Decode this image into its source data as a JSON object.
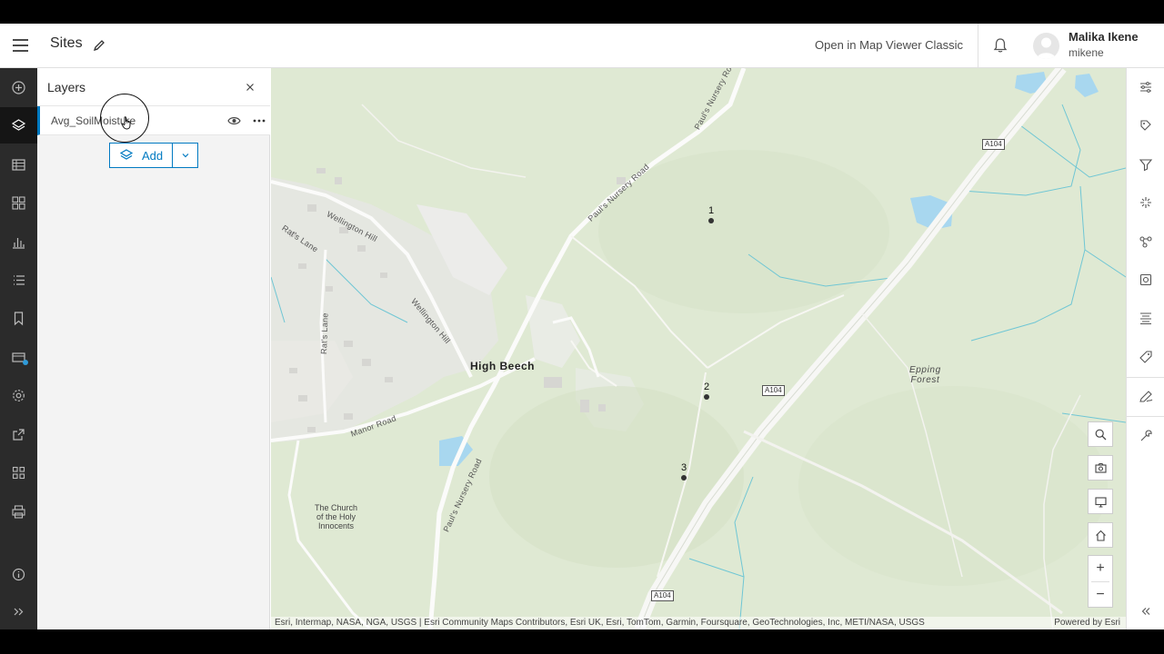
{
  "header": {
    "app_title": "Sites",
    "open_classic_label": "Open in Map Viewer Classic",
    "user_name": "Malika Ikene",
    "user_login": "mikene"
  },
  "layers_panel": {
    "title": "Layers",
    "layers": [
      {
        "name": "Avg_SoilMoisture"
      }
    ],
    "add_label": "Add"
  },
  "map": {
    "places": {
      "high_beech": "High Beech",
      "church": "The Church\nof the Holy\nInnocents",
      "epping_forest": "Epping\nForest"
    },
    "roads": {
      "pauls_nursery_1": "Paul's Nursery Road",
      "pauls_nursery_2": "Paul's Nursery Road",
      "pauls_nursery_3": "Paul's Nursery Road",
      "wellington_1": "Wellington Hill",
      "wellington_2": "Wellington Hill",
      "rats_lane_1": "Rat's Lane",
      "rats_lane_2": "Rat's Lane",
      "manor_road": "Manor Road"
    },
    "shields": [
      "A104",
      "A104",
      "A104"
    ],
    "points": [
      "1",
      "2",
      "3"
    ],
    "attribution": "Esri, Intermap, NASA, NGA, USGS | Esri Community Maps Contributors, Esri UK, Esri, TomTom, Garmin, Foursquare, GeoTechnologies, Inc, METI/NASA, USGS",
    "powered_by": "Powered by Esri"
  },
  "icons": {
    "left_bar": [
      "add-icon",
      "layers-icon",
      "table-icon",
      "basemap-icon",
      "charts-icon",
      "legend-icon",
      "bookmark-icon",
      "map-properties-icon",
      "settings-icon",
      "share-icon",
      "apps-icon",
      "print-icon",
      "info-icon",
      "expand-icon"
    ],
    "right_bar": [
      "properties-icon",
      "styles-icon",
      "filter-icon",
      "effects-icon",
      "pop-ups-icon",
      "fields-icon",
      "labels-icon",
      "configure-icon",
      "sketch-icon",
      "measure-icon",
      "collapse-icon"
    ]
  },
  "colors": {
    "accent": "#007ac2",
    "dark_bar": "#2b2b2b",
    "map_base": "#dfe9d3",
    "water": "#a8d7ef"
  }
}
